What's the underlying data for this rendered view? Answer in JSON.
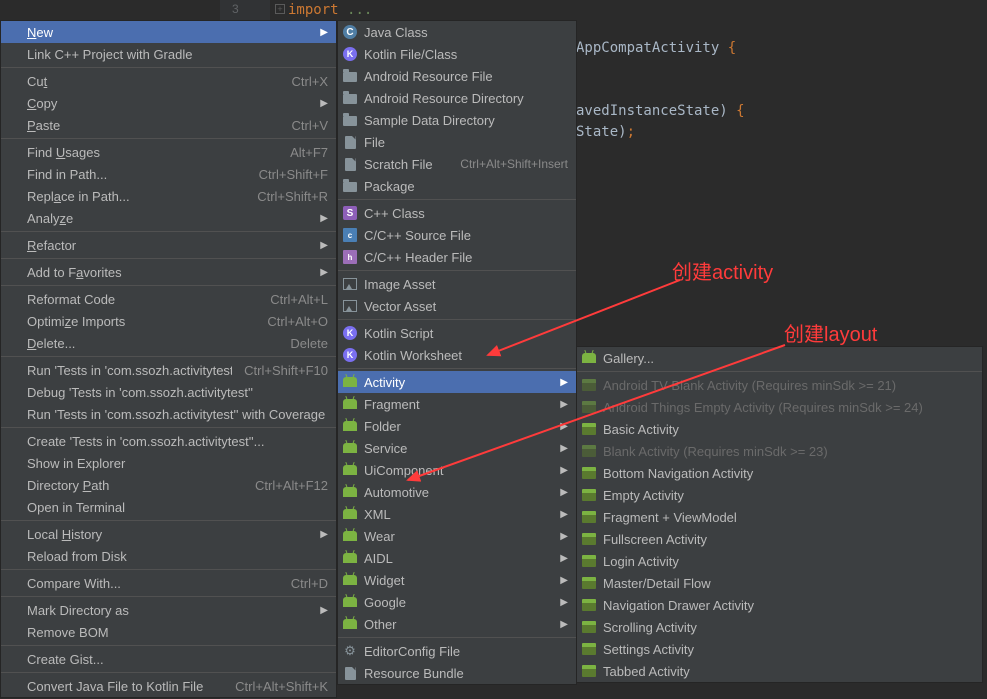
{
  "editor": {
    "line_no": "3",
    "import_kw": "import",
    "import_ellipsis": "...",
    "code_frag1a": "AppCompatActivity ",
    "code_frag1b": "{",
    "code_frag2a": "avedInstanceState) ",
    "code_frag2b": "{",
    "code_frag3a": "State)",
    "code_frag3b": ";"
  },
  "menu1": {
    "new": "New",
    "cpp_gradle": "Link C++ Project with Gradle",
    "cut": "Cut",
    "cut_sc": "Ctrl+X",
    "copy": "Copy",
    "paste": "Paste",
    "paste_sc": "Ctrl+V",
    "find_usages": "Find Usages",
    "find_usages_sc": "Alt+F7",
    "find_in_path": "Find in Path...",
    "find_in_path_sc": "Ctrl+Shift+F",
    "replace_in_path": "Replace in Path...",
    "replace_in_path_sc": "Ctrl+Shift+R",
    "analyze": "Analyze",
    "refactor": "Refactor",
    "add_fav": "Add to Favorites",
    "reformat": "Reformat Code",
    "reformat_sc": "Ctrl+Alt+L",
    "optimize": "Optimize Imports",
    "optimize_sc": "Ctrl+Alt+O",
    "delete": "Delete...",
    "delete_sc": "Delete",
    "run_tests": "Run 'Tests in 'com.ssozh.activitytest''",
    "run_tests_sc": "Ctrl+Shift+F10",
    "debug_tests": "Debug 'Tests in 'com.ssozh.activitytest''",
    "coverage_tests": "Run 'Tests in 'com.ssozh.activitytest'' with Coverage",
    "create_tests": "Create 'Tests in 'com.ssozh.activitytest''...",
    "show_explorer": "Show in Explorer",
    "dir_path": "Directory Path",
    "dir_path_sc": "Ctrl+Alt+F12",
    "open_terminal": "Open in Terminal",
    "local_history": "Local History",
    "reload_disk": "Reload from Disk",
    "compare": "Compare With...",
    "compare_sc": "Ctrl+D",
    "mark_dir": "Mark Directory as",
    "remove_bom": "Remove BOM",
    "create_gist": "Create Gist...",
    "convert_kotlin": "Convert Java File to Kotlin File",
    "convert_kotlin_sc": "Ctrl+Alt+Shift+K"
  },
  "menu2": {
    "java_class": "Java Class",
    "kotlin_class": "Kotlin File/Class",
    "android_res_file": "Android Resource File",
    "android_res_dir": "Android Resource Directory",
    "sample_data": "Sample Data Directory",
    "file": "File",
    "scratch": "Scratch File",
    "scratch_sc": "Ctrl+Alt+Shift+Insert",
    "package": "Package",
    "cpp_class": "C++ Class",
    "c_source": "C/C++ Source File",
    "c_header": "C/C++ Header File",
    "image_asset": "Image Asset",
    "vector_asset": "Vector Asset",
    "kotlin_script": "Kotlin Script",
    "kotlin_worksheet": "Kotlin Worksheet",
    "activity": "Activity",
    "fragment": "Fragment",
    "folder": "Folder",
    "service": "Service",
    "uicomponent": "UiComponent",
    "automotive": "Automotive",
    "xml": "XML",
    "wear": "Wear",
    "aidl": "AIDL",
    "widget": "Widget",
    "google": "Google",
    "other": "Other",
    "editorconfig": "EditorConfig File",
    "resource_bundle": "Resource Bundle"
  },
  "menu3": {
    "gallery": "Gallery...",
    "tv_blank": "Android TV Blank Activity (Requires minSdk >= 21)",
    "things_empty": "Android Things Empty Activity (Requires minSdk >= 24)",
    "basic": "Basic Activity",
    "blank": "Blank Activity (Requires minSdk >= 23)",
    "bottom_nav": "Bottom Navigation Activity",
    "empty": "Empty Activity",
    "frag_vm": "Fragment + ViewModel",
    "fullscreen": "Fullscreen Activity",
    "login": "Login Activity",
    "master_detail": "Master/Detail Flow",
    "nav_drawer": "Navigation Drawer Activity",
    "scrolling": "Scrolling Activity",
    "settings": "Settings Activity",
    "tabbed": "Tabbed Activity"
  },
  "annotations": {
    "create_activity": "创建activity",
    "create_layout": "创建layout"
  }
}
